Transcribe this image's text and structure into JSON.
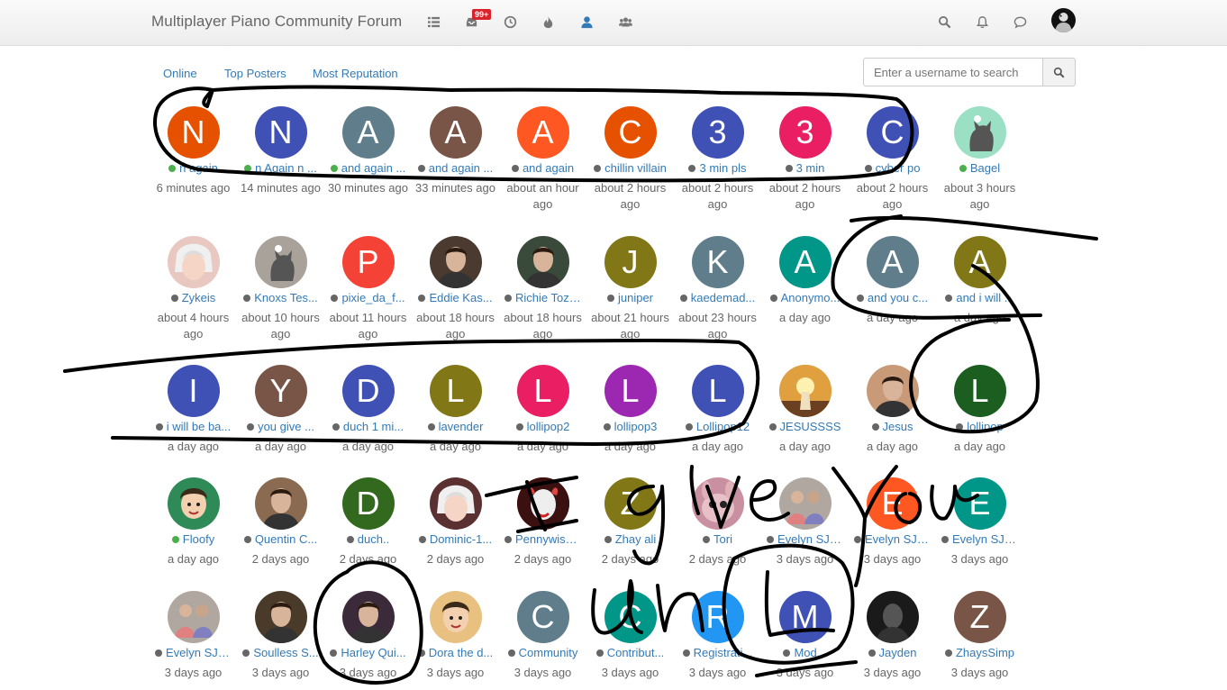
{
  "header": {
    "title": "Multiplayer Piano Community Forum",
    "notification_badge": "99+",
    "nav_icons": [
      "list-icon",
      "inbox-icon",
      "clock-icon",
      "fire-icon",
      "user-icon",
      "users-icon"
    ],
    "right_icons": [
      "search-icon",
      "bell-icon",
      "chat-icon"
    ]
  },
  "tabs": [
    "Online",
    "Top Posters",
    "Most Reputation"
  ],
  "search": {
    "placeholder": "Enter a username to search"
  },
  "colors": {
    "online": "#4cae4c",
    "offline": "#666666",
    "link": "#337ab7"
  },
  "users": [
    {
      "name": "n again",
      "time": "6 minutes ago",
      "letter": "N",
      "color": "#e65100",
      "status": "online"
    },
    {
      "name": "n Again n ...",
      "time": "14 minutes ago",
      "letter": "N",
      "color": "#3f51b5",
      "status": "online"
    },
    {
      "name": "and again ...",
      "time": "30 minutes ago",
      "letter": "A",
      "color": "#607d8b",
      "status": "online"
    },
    {
      "name": "and again ...",
      "time": "33 minutes ago",
      "letter": "A",
      "color": "#795548",
      "status": "offline"
    },
    {
      "name": "and again",
      "time": "about an hour ago",
      "letter": "A",
      "color": "#ff5722",
      "status": "offline"
    },
    {
      "name": "chillin villain",
      "time": "about 2 hours ago",
      "letter": "C",
      "color": "#e65100",
      "status": "offline"
    },
    {
      "name": "3 min pls",
      "time": "about 2 hours ago",
      "letter": "3",
      "color": "#3f51b5",
      "status": "offline"
    },
    {
      "name": "3 min",
      "time": "about 2 hours ago",
      "letter": "3",
      "color": "#e91e63",
      "status": "offline"
    },
    {
      "name": "cyber po",
      "time": "about 2 hours ago",
      "letter": "C",
      "color": "#3f51b5",
      "status": "offline"
    },
    {
      "name": "Bagel",
      "time": "about 3 hours ago",
      "letter": "",
      "color": "#9be0c4",
      "status": "online",
      "img": "cat-photo"
    },
    {
      "name": "Zykeis",
      "time": "about 4 hours ago",
      "letter": "",
      "color": "#e8c8c0",
      "status": "offline",
      "img": "anime-photo"
    },
    {
      "name": "Knoxs Tes...",
      "time": "about 10 hours ago",
      "letter": "",
      "color": "#a8a29a",
      "status": "offline",
      "img": "cat-photo"
    },
    {
      "name": "pixie_da_f...",
      "time": "about 11 hours ago",
      "letter": "P",
      "color": "#f44336",
      "status": "offline"
    },
    {
      "name": "Eddie Kas...",
      "time": "about 18 hours ago",
      "letter": "",
      "color": "#4a3a30",
      "status": "offline",
      "img": "person-photo"
    },
    {
      "name": "Richie Tozi...",
      "time": "about 18 hours ago",
      "letter": "",
      "color": "#3a4a3a",
      "status": "offline",
      "img": "person-photo"
    },
    {
      "name": "juniper",
      "time": "about 21 hours ago",
      "letter": "J",
      "color": "#827717",
      "status": "offline"
    },
    {
      "name": "kaedemad...",
      "time": "about 23 hours ago",
      "letter": "K",
      "color": "#607d8b",
      "status": "offline"
    },
    {
      "name": "Anonymo...",
      "time": "a day ago",
      "letter": "A",
      "color": "#009688",
      "status": "offline"
    },
    {
      "name": "and you c...",
      "time": "a day ago",
      "letter": "A",
      "color": "#607d8b",
      "status": "offline"
    },
    {
      "name": "and i will ...",
      "time": "a day ago",
      "letter": "A",
      "color": "#827717",
      "status": "offline"
    },
    {
      "name": "i will be ba...",
      "time": "a day ago",
      "letter": "I",
      "color": "#3f51b5",
      "status": "offline"
    },
    {
      "name": "you give ...",
      "time": "a day ago",
      "letter": "Y",
      "color": "#795548",
      "status": "offline"
    },
    {
      "name": "duch 1 mi...",
      "time": "a day ago",
      "letter": "D",
      "color": "#3f51b5",
      "status": "offline"
    },
    {
      "name": "lavender",
      "time": "a day ago",
      "letter": "L",
      "color": "#827717",
      "status": "offline"
    },
    {
      "name": "lollipop2",
      "time": "a day ago",
      "letter": "L",
      "color": "#e91e63",
      "status": "offline"
    },
    {
      "name": "lollipop3",
      "time": "a day ago",
      "letter": "L",
      "color": "#9c27b0",
      "status": "offline"
    },
    {
      "name": "Lollipop12",
      "time": "a day ago",
      "letter": "L",
      "color": "#3f51b5",
      "status": "offline"
    },
    {
      "name": "JESUSSSS",
      "time": "a day ago",
      "letter": "",
      "color": "#d89a40",
      "status": "offline",
      "img": "sunset-photo"
    },
    {
      "name": "Jesus",
      "time": "a day ago",
      "letter": "",
      "color": "#c89a78",
      "status": "offline",
      "img": "person-photo"
    },
    {
      "name": "lollipop",
      "time": "a day ago",
      "letter": "L",
      "color": "#1b5e20",
      "status": "offline"
    },
    {
      "name": "Floofy",
      "time": "a day ago",
      "letter": "",
      "color": "#2e8b57",
      "status": "online",
      "img": "cartoon-photo"
    },
    {
      "name": "Quentin C...",
      "time": "2 days ago",
      "letter": "",
      "color": "#8a6a50",
      "status": "offline",
      "img": "person-photo"
    },
    {
      "name": "duch..",
      "time": "2 days ago",
      "letter": "D",
      "color": "#33691e",
      "status": "offline"
    },
    {
      "name": "Dominic-1...",
      "time": "2 days ago",
      "letter": "",
      "color": "#5a3030",
      "status": "offline",
      "img": "anime-photo"
    },
    {
      "name": "Pennywise...",
      "time": "2 days ago",
      "letter": "",
      "color": "#b02020",
      "status": "offline",
      "img": "clown-photo"
    },
    {
      "name": "Zhay ali",
      "time": "2 days ago",
      "letter": "Z",
      "color": "#827717",
      "status": "offline"
    },
    {
      "name": "Tori",
      "time": "2 days ago",
      "letter": "",
      "color": "#c890a0",
      "status": "offline",
      "img": "creature-photo"
    },
    {
      "name": "Evelyn SJ A...",
      "time": "3 days ago",
      "letter": "",
      "color": "#b0a8a0",
      "status": "offline",
      "img": "group-photo"
    },
    {
      "name": "Evelyn SJ A...",
      "time": "3 days ago",
      "letter": "E",
      "color": "#ff5722",
      "status": "offline"
    },
    {
      "name": "Evelyn SJ A...",
      "time": "3 days ago",
      "letter": "E",
      "color": "#009688",
      "status": "offline"
    },
    {
      "name": "Evelyn SJ A...",
      "time": "3 days ago",
      "letter": "",
      "color": "#b0a8a0",
      "status": "offline",
      "img": "group-photo"
    },
    {
      "name": "Soulless S...",
      "time": "3 days ago",
      "letter": "",
      "color": "#4a3a2a",
      "status": "offline",
      "img": "person-photo"
    },
    {
      "name": "Harley Qui...",
      "time": "3 days ago",
      "letter": "",
      "color": "#3a2a3a",
      "status": "offline",
      "img": "person-photo"
    },
    {
      "name": "Dora the d...",
      "time": "3 days ago",
      "letter": "",
      "color": "#e8c080",
      "status": "offline",
      "img": "cartoon-photo"
    },
    {
      "name": "Community",
      "time": "3 days ago",
      "letter": "C",
      "color": "#607d8b",
      "status": "offline"
    },
    {
      "name": "Contribut...",
      "time": "3 days ago",
      "letter": "C",
      "color": "#009688",
      "status": "offline"
    },
    {
      "name": "Registrati...",
      "time": "3 days ago",
      "letter": "R",
      "color": "#2196f3",
      "status": "offline"
    },
    {
      "name": "Mod...",
      "time": "3 days ago",
      "letter": "M",
      "color": "#3f51b5",
      "status": "offline"
    },
    {
      "name": "Jayden",
      "time": "3 days ago",
      "letter": "",
      "color": "#1a1a1a",
      "status": "offline",
      "img": "dark-photo"
    },
    {
      "name": "ZhaysSimp",
      "time": "3 days ago",
      "letter": "Z",
      "color": "#795548",
      "status": "offline"
    }
  ]
}
